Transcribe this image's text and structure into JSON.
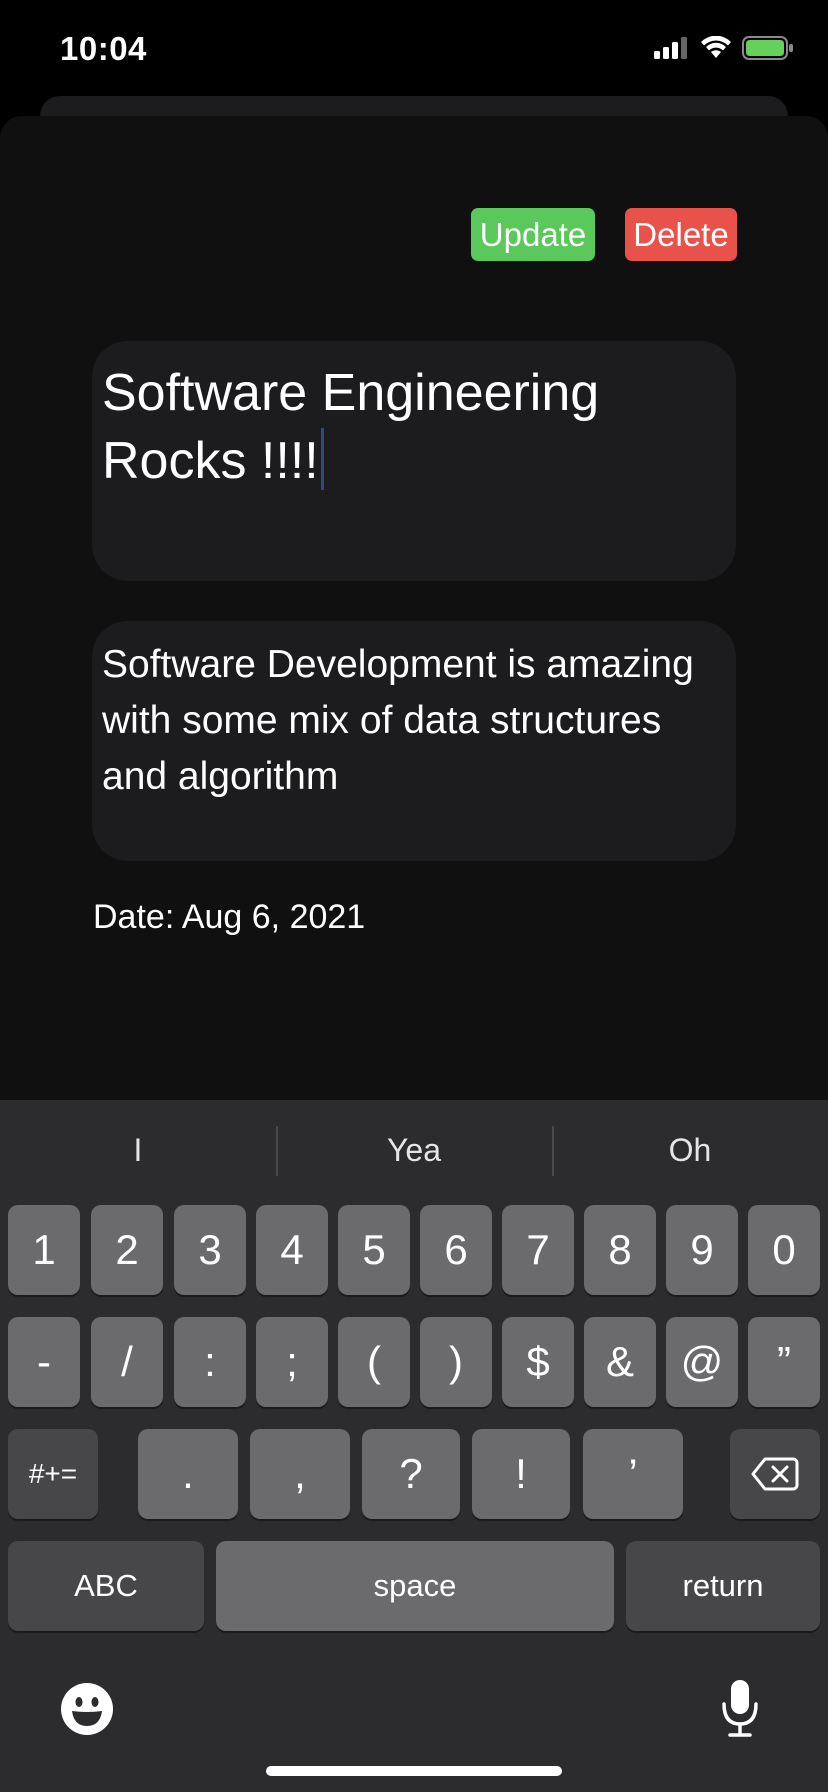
{
  "status_bar": {
    "time": "10:04"
  },
  "actions": {
    "update_label": "Update",
    "delete_label": "Delete",
    "update_color": "#5ac85a",
    "delete_color": "#e8524a"
  },
  "note": {
    "title": "Software Engineering Rocks !!!!",
    "body": "Software Development is amazing with some mix of data structures and algorithm",
    "date": "Date: Aug 6, 2021"
  },
  "keyboard": {
    "suggestions": [
      "I",
      "Yea",
      "Oh"
    ],
    "row1": [
      "1",
      "2",
      "3",
      "4",
      "5",
      "6",
      "7",
      "8",
      "9",
      "0"
    ],
    "row2": [
      "-",
      "/",
      ":",
      ";",
      "(",
      ")",
      "$",
      "&",
      "@",
      "”"
    ],
    "row3": {
      "shift": "#+=",
      "keys": [
        ".",
        ",",
        "?",
        "!",
        "’"
      ]
    },
    "row4": {
      "abc": "ABC",
      "space": "space",
      "return": "return"
    },
    "icons": [
      "delete-icon",
      "emoji-icon",
      "microphone-icon"
    ]
  }
}
